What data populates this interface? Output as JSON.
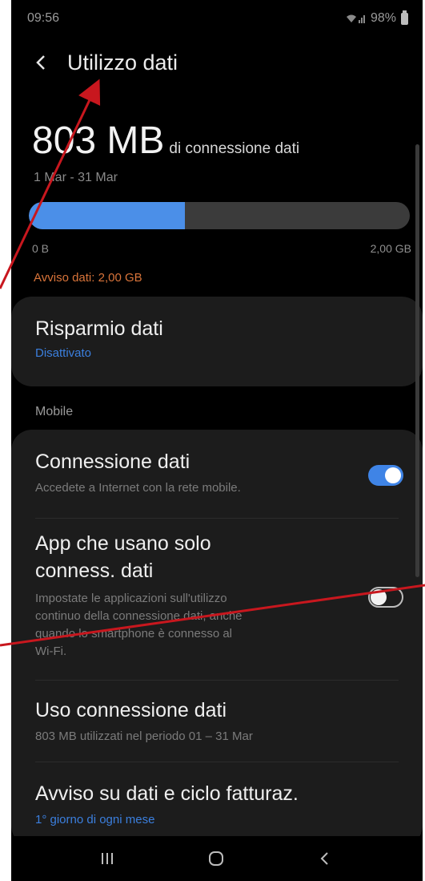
{
  "status_bar": {
    "time": "09:56",
    "battery": "98%"
  },
  "header": {
    "title": "Utilizzo dati"
  },
  "usage": {
    "amount": "803 MB",
    "description": "di connessione dati",
    "period": "1 Mar - 31 Mar",
    "bar_min": "0 B",
    "bar_max": "2,00 GB",
    "used_fraction": 0.41,
    "warning": "Avviso dati: 2,00 GB"
  },
  "data_saver": {
    "title": "Risparmio dati",
    "status": "Disattivato"
  },
  "mobile_section": {
    "label": "Mobile",
    "items": [
      {
        "title": "Connessione dati",
        "subtitle": "Accedete a Internet con la rete mobile.",
        "toggle": "on"
      },
      {
        "title_line1": "App che usano solo",
        "title_line2": "conness. dati",
        "subtitle_line1": "Impostate le applicazioni sull'utilizzo",
        "subtitle_line2": "continuo della connessione dati, anche",
        "subtitle_line3": "quando lo smartphone è connesso al",
        "subtitle_line4": "Wi-Fi.",
        "toggle": "off"
      },
      {
        "title": "Uso connessione dati",
        "subtitle": "803 MB utilizzati nel periodo 01 – 31 Mar"
      },
      {
        "title": "Avviso su dati e ciclo fatturaz.",
        "subtitle": "1° giorno di ogni mese"
      }
    ]
  },
  "colors": {
    "accent": "#3f84e6",
    "annotation": "#c8171e",
    "warning": "#d9743a"
  },
  "icons": {
    "back": "back-arrow-icon",
    "recent": "recent-apps-icon",
    "home": "home-icon",
    "nav_back": "nav-back-icon"
  }
}
